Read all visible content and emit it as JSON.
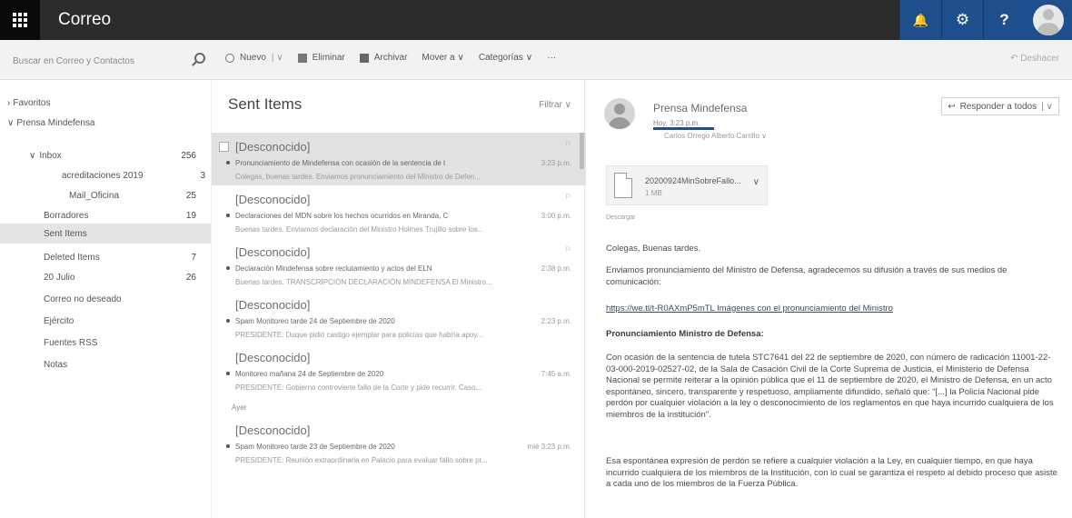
{
  "app": {
    "title": "Correo"
  },
  "topbar": {
    "bell_glyph": "🔔",
    "gear_glyph": "⚙",
    "help_glyph": "?"
  },
  "search": {
    "placeholder": "Buscar en Correo y Contactos"
  },
  "commands": {
    "new_label": "Nuevo",
    "delete_label": "Eliminar",
    "archive_label": "Archivar",
    "move_label": "Mover a",
    "categories_label": "Categorías",
    "more_label": "···",
    "undo_label": "Deshacer"
  },
  "folders": [
    {
      "label": "Favoritos",
      "count": ""
    },
    {
      "label": "Prensa Mindefensa",
      "count": ""
    },
    {
      "label": "Inbox",
      "count": "256"
    },
    {
      "label": "acreditaciones 2019",
      "count": "3"
    },
    {
      "label": "Mail_Oficina",
      "count": "25"
    },
    {
      "label": "Borradores",
      "count": "19"
    },
    {
      "label": "Sent Items",
      "count": ""
    },
    {
      "label": "Deleted Items",
      "count": "7"
    },
    {
      "label": "20 Julio",
      "count": "26"
    },
    {
      "label": "Correo no deseado",
      "count": ""
    },
    {
      "label": "Ejército",
      "count": ""
    },
    {
      "label": "Fuentes RSS",
      "count": ""
    },
    {
      "label": "Notas",
      "count": ""
    }
  ],
  "list": {
    "title": "Sent Items",
    "filter_label": "Filtrar",
    "group_yesterday": "Ayer",
    "messages": [
      {
        "sender": "[Desconocido]",
        "subject": "Pronunciamiento de Mindefensa con ocasión de la sentencia de t",
        "time": "3:23 p.m.",
        "preview": "Colegas, buenas tardes. Enviamos pronunciamiento del Ministro de Defen..."
      },
      {
        "sender": "[Desconocido]",
        "subject": "Declaraciones del MDN sobre los hechos ocurridos en Miranda, C",
        "time": "3:00 p.m.",
        "preview": "Buenas tardes. Enviamos declaración del Ministro Holmes Trujillo sobre los..."
      },
      {
        "sender": "[Desconocido]",
        "subject": "Declaración Mindefensa sobre reclutamiento y actos del ELN",
        "time": "2:38 p.m.",
        "preview": "Buenas tardes. TRANSCRIPCIÓN DECLARACIÓN MINDEFENSA El Ministro..."
      },
      {
        "sender": "[Desconocido]",
        "subject": "Spam Monitoreo tarde 24 de Septiembre de 2020",
        "time": "2:23 p.m.",
        "preview": "PRESIDENTE: Duque pidió castigo ejemplar para policías que habría apoy..."
      },
      {
        "sender": "[Desconocido]",
        "subject": "Monitoreo mañana 24 de Septiembre de 2020",
        "time": "7:45 a.m.",
        "preview": "PRESIDENTE: Gobierno controvierte fallo de la Corte y pide recurrir. Caso..."
      },
      {
        "sender": "[Desconocido]",
        "subject": "Spam Monitoreo tarde 23 de Septiembre de 2020",
        "time": "mié 3:23 p.m.",
        "preview": "PRESIDENTE: Reunión extraordinaria en Palacio para evaluar fallo sobre pr..."
      }
    ]
  },
  "reading": {
    "from": "Prensa Mindefensa",
    "date": "Hoy, 3:23 p.m.",
    "to": "Carlos Orrego Alberto Carrillo",
    "reply_all_label": "Responder a todos",
    "attachment": {
      "name": "20200924MinSobreFallo...",
      "size": "1 MB"
    },
    "download_label": "Descargar",
    "greeting": "Colegas, Buenas tardes.",
    "intro": "Enviamos pronunciamiento del Ministro de Defensa, agradecemos su difusión a través de sus medios de comunicación:",
    "link_line": "https://we.tl/t-R0AXmP5mTL Imágenes con el pronunciamiento del Ministro",
    "heading": "Pronunciamiento Ministro de Defensa:",
    "paragraph1": "Con ocasión de la sentencia de tutela STC7641 del 22 de septiembre de 2020, con número de radicación 11001-22-03-000-2019-02527-02, de la Sala de Casación Civil de la Corte Suprema de Justicia, el Ministerio de Defensa Nacional se permite reiterar a la opinión pública que el 11 de septiembre de 2020, el Ministro de Defensa, en un acto espontáneo, sincero, transparente y respetuoso, ampliamente difundido, señaló que: \"[...] la Policía Nacional pide perdón por cualquier violación a la ley o desconocimiento de los reglamentos en que haya incurrido cualquiera de los miembros de la institución\".",
    "paragraph2": "Esa espontánea expresión de perdón se refiere a cualquier violación a la Ley, en cualquier tiempo, en que haya incurrido cualquiera de los miembros de la Institución, con lo cual se garantiza el respeto al debido proceso que asiste a cada uno de los miembros de la Fuerza Pública."
  },
  "colors": {
    "topbar": "#2b2b2b",
    "accent": "#1f4e8c",
    "selected": "#e2e2e2"
  }
}
